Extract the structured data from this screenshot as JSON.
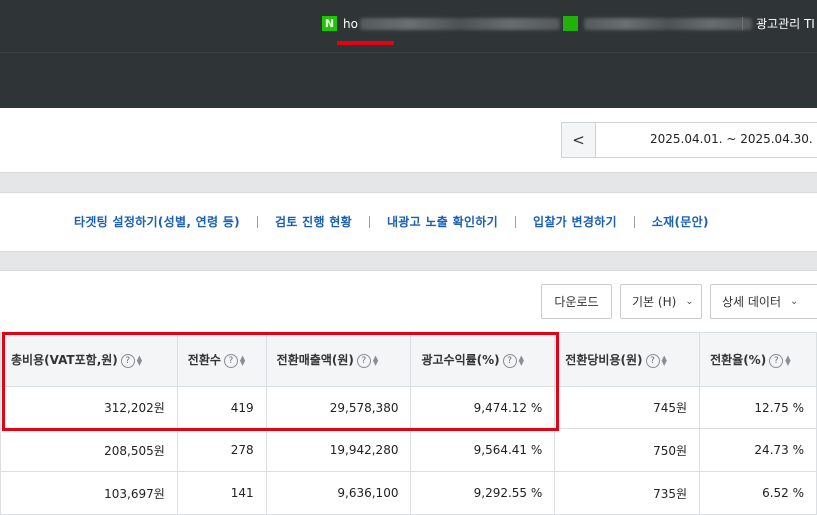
{
  "header": {
    "account1_prefix": "ho",
    "account1_badge": "N",
    "admin_link": "광고관리 TI"
  },
  "date_range": {
    "prev_label": "<",
    "text": "2025.04.01. ~ 2025.04.30."
  },
  "links": [
    "타겟팅 설정하기(성별, 연령 등)",
    "검토 진행 현황",
    "내광고 노출 확인하기",
    "입찰가 변경하기",
    "소재(문안)"
  ],
  "toolbar": {
    "download_label": "다운로드",
    "basic_label": "기본 (H)",
    "detail_label": "상세 데이터"
  },
  "table": {
    "columns": [
      "총비용(VAT포함,원)",
      "전환수",
      "전환매출액(원)",
      "광고수익률(%)",
      "전환당비용(원)",
      "전환율(%)"
    ],
    "rows": [
      [
        "312,202원",
        "419",
        "29,578,380",
        "9,474.12 %",
        "745원",
        "12.75 %"
      ],
      [
        "208,505원",
        "278",
        "19,942,280",
        "9,564.41 %",
        "750원",
        "24.73 %"
      ],
      [
        "103,697원",
        "141",
        "9,636,100",
        "9,292.55 %",
        "735원",
        "6.52 %"
      ]
    ]
  },
  "icons": {
    "help": "?",
    "sort": "sort-icon",
    "caret": "chevron-down-icon"
  },
  "colors": {
    "header_bg": "#2f3437",
    "highlight_red": "#e50012",
    "link_blue": "#1a5fb4",
    "naver_green": "#1ec800"
  }
}
